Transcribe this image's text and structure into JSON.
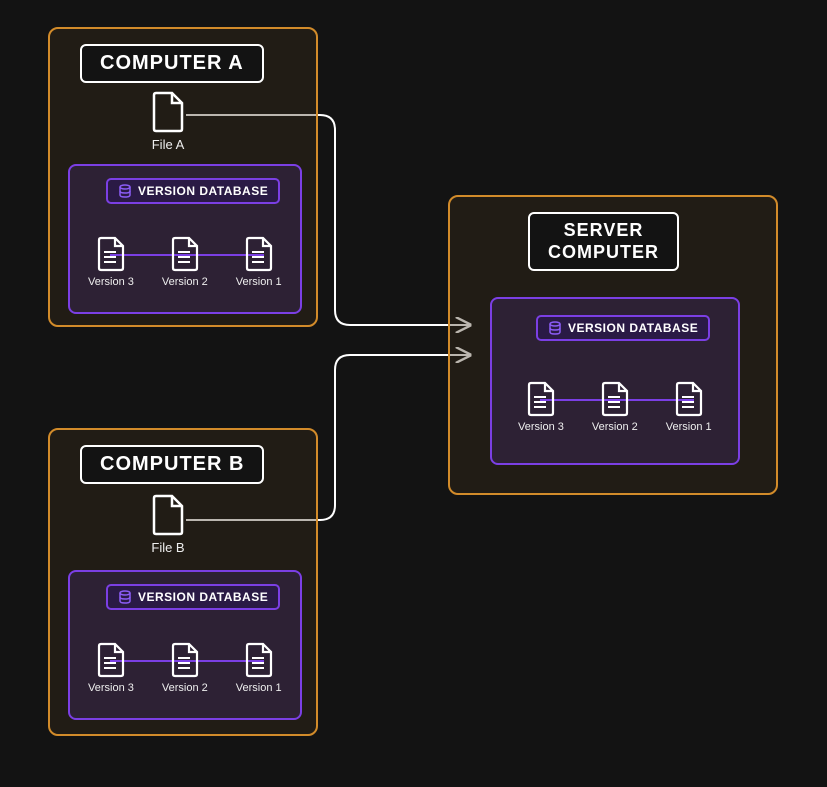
{
  "nodes": {
    "computerA": {
      "title": "COMPUTER A",
      "file_label": "File A",
      "vdb_title": "VERSION DATABASE",
      "versions": [
        "Version 3",
        "Version 2",
        "Version 1"
      ]
    },
    "computerB": {
      "title": "COMPUTER B",
      "file_label": "File B",
      "vdb_title": "VERSION DATABASE",
      "versions": [
        "Version 3",
        "Version 2",
        "Version 1"
      ]
    },
    "server": {
      "title": "SERVER\nCOMPUTER",
      "vdb_title": "VERSION DATABASE",
      "versions": [
        "Version 3",
        "Version 2",
        "Version 1"
      ]
    }
  }
}
